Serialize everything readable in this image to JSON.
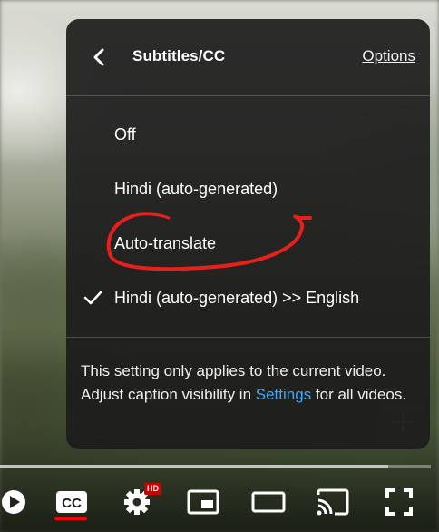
{
  "menu": {
    "title": "Subtitles/CC",
    "options_label": "Options",
    "items": [
      {
        "label": "Off",
        "selected": false
      },
      {
        "label": "Hindi (auto-generated)",
        "selected": false
      },
      {
        "label": "Auto-translate",
        "selected": false
      },
      {
        "label": "Hindi (auto-generated) >> English",
        "selected": true
      }
    ],
    "note_part1": "This setting only applies to the current video. Adjust caption visibility in ",
    "note_link": "Settings",
    "note_part2": " for all videos."
  },
  "player": {
    "hd_badge": "HD",
    "progress_fraction": 0.9,
    "accent_color": "#ff0000",
    "link_color": "#3ea6ff"
  },
  "icons": [
    "chevron-left-icon",
    "check-icon",
    "plus-icon",
    "play-icon",
    "cc-icon",
    "settings-gear-icon",
    "miniplayer-icon",
    "theater-mode-icon",
    "cast-icon",
    "fullscreen-icon"
  ]
}
